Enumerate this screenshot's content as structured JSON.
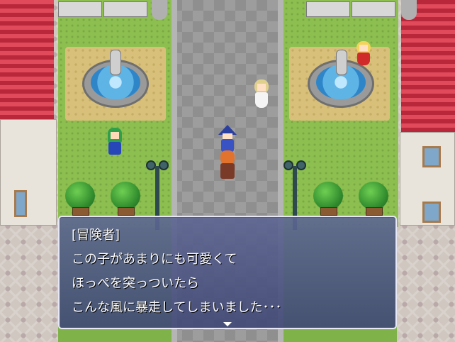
{
  "dialog": {
    "speaker": "[冒険者]",
    "lines": [
      "この子があまりにも可愛くて",
      "ほっぺを突っついたら",
      "こんな風に暴走してしまいました･･･"
    ],
    "continue_indicator": "down-arrow-icon"
  },
  "colors": {
    "roof": "#d23a4c",
    "grass": "#8cbf50",
    "road": "#949494",
    "dialog_bg": "#4d5684",
    "dialog_border": "#e7e7f5"
  }
}
